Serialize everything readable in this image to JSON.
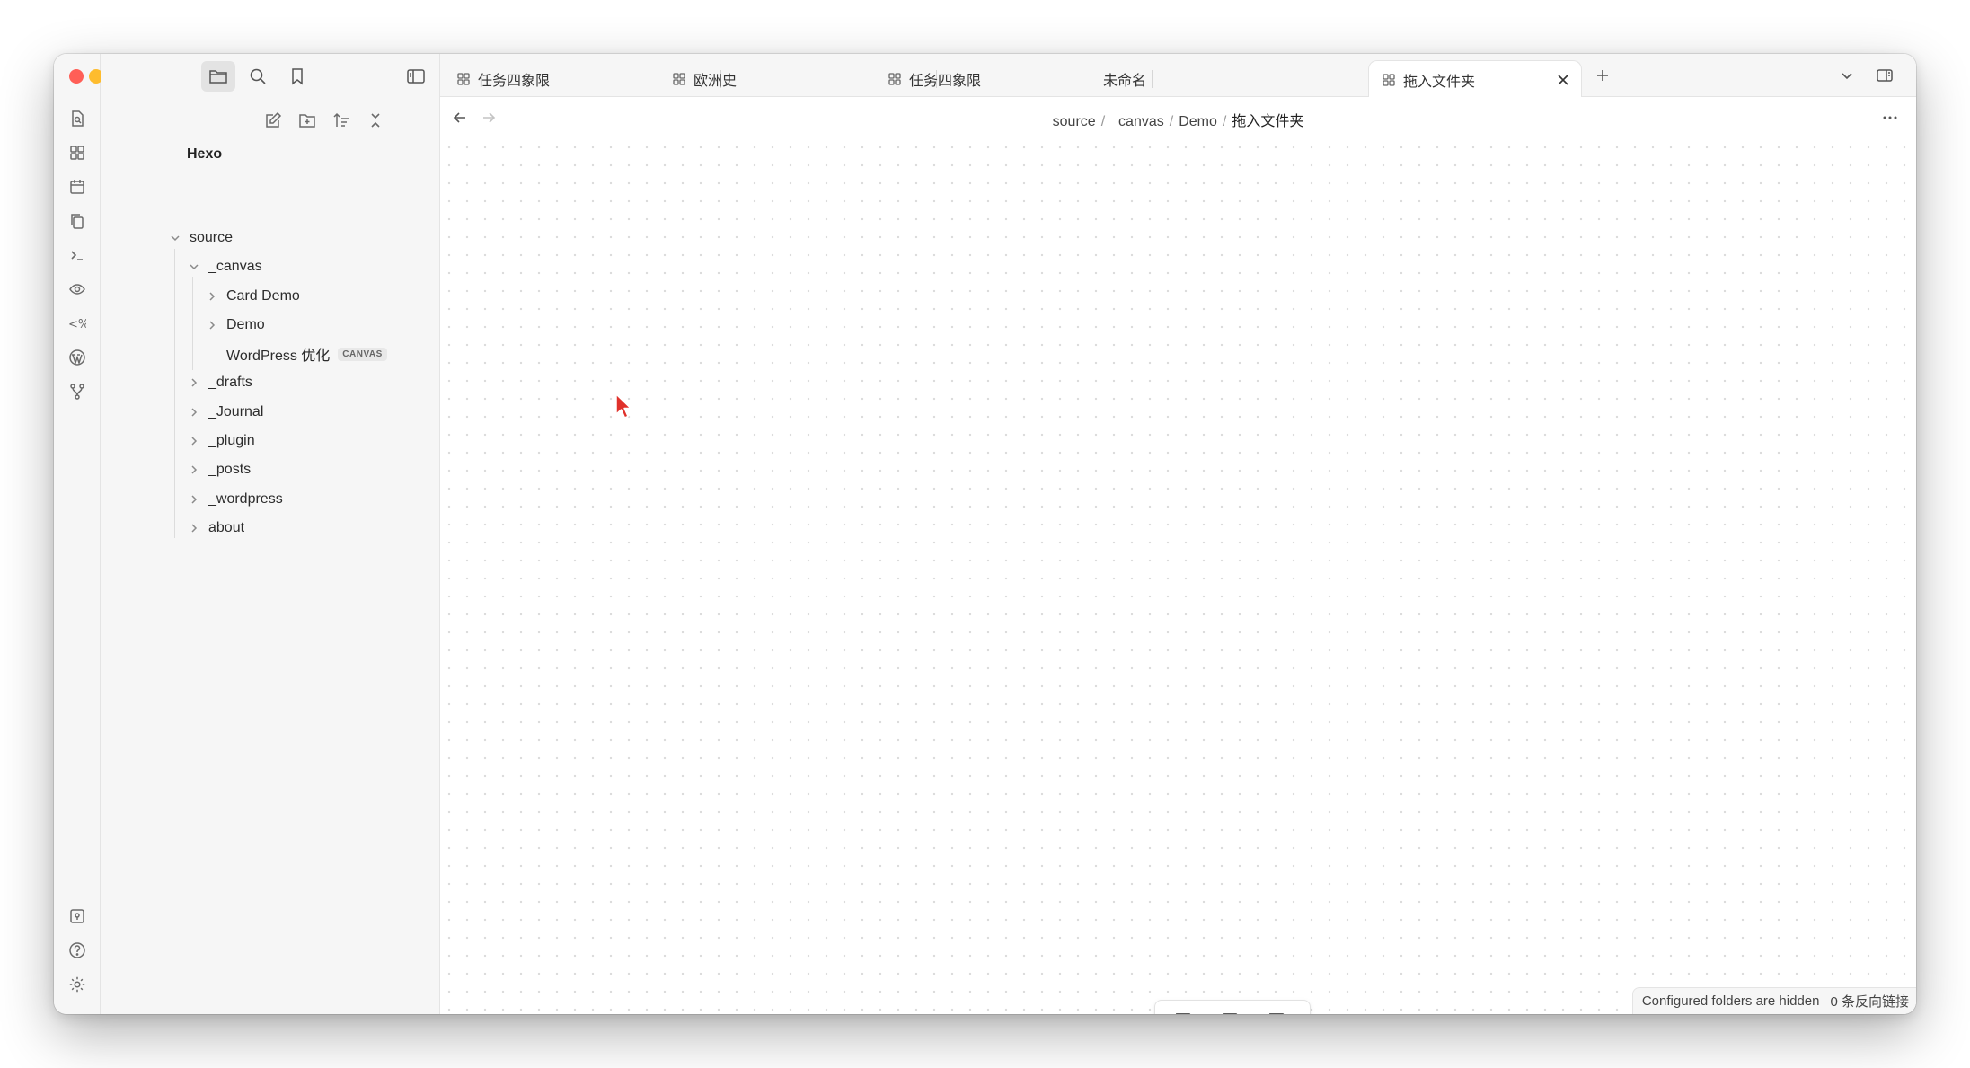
{
  "sidebar": {
    "vault_name": "Hexo",
    "tree": [
      {
        "label": "source",
        "expanded": true
      },
      {
        "label": "_canvas",
        "expanded": true
      },
      {
        "label": "Card Demo",
        "expanded": false
      },
      {
        "label": "Demo",
        "expanded": false
      },
      {
        "label": "WordPress 优化",
        "tag": "CANVAS"
      },
      {
        "label": "_drafts",
        "expanded": false
      },
      {
        "label": "_Journal",
        "expanded": false
      },
      {
        "label": "_plugin",
        "expanded": false
      },
      {
        "label": "_posts",
        "expanded": false
      },
      {
        "label": "_wordpress",
        "expanded": false
      },
      {
        "label": "about",
        "expanded": false
      }
    ]
  },
  "tabs": [
    {
      "label": "任务四象限",
      "icon": "canvas-icon"
    },
    {
      "label": "欧洲史",
      "icon": "canvas-icon"
    },
    {
      "label": "任务四象限",
      "icon": "canvas-icon"
    },
    {
      "label": "未命名",
      "icon": ""
    },
    {
      "label": "拖入文件夹",
      "icon": "canvas-icon",
      "active": true
    }
  ],
  "breadcrumb": {
    "parts": [
      "source",
      "_canvas",
      "Demo"
    ],
    "current": "拖入文件夹",
    "separator": "/"
  },
  "status_bar": {
    "hidden_notice": "Configured folders are hidden",
    "backlinks": "0 条反向链接"
  },
  "colors": {
    "traffic_red": "#ff5f57",
    "traffic_yellow": "#febc2e",
    "traffic_green": "#28c840",
    "cursor": "#e0312b"
  }
}
